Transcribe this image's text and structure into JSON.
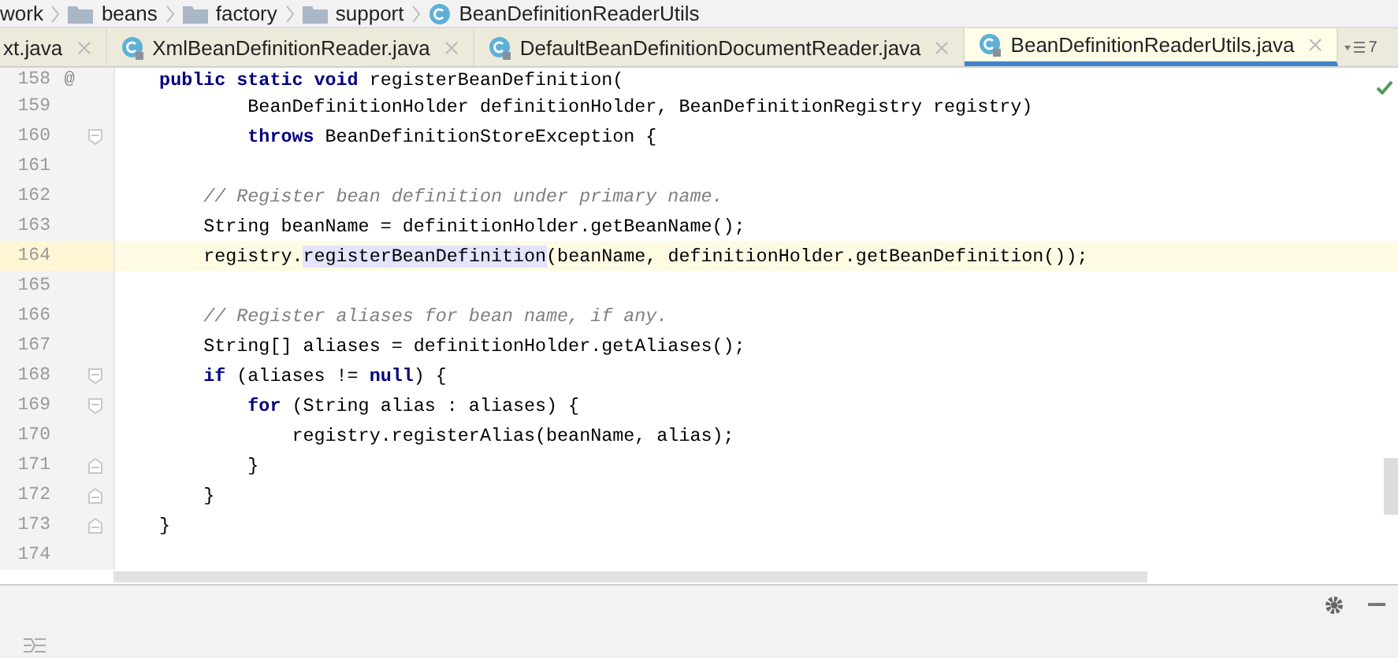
{
  "breadcrumbs": [
    {
      "label": "work",
      "kind": "text"
    },
    {
      "label": "beans",
      "kind": "folder"
    },
    {
      "label": "factory",
      "kind": "folder"
    },
    {
      "label": "support",
      "kind": "folder"
    },
    {
      "label": "BeanDefinitionReaderUtils",
      "kind": "class"
    }
  ],
  "tabs": [
    {
      "label": "xt.java",
      "selected": false,
      "kind": "cut"
    },
    {
      "label": "XmlBeanDefinitionReader.java",
      "selected": false,
      "kind": "class"
    },
    {
      "label": "DefaultBeanDefinitionDocumentReader.java",
      "selected": false,
      "kind": "class"
    },
    {
      "label": "BeanDefinitionReaderUtils.java",
      "selected": true,
      "kind": "class"
    }
  ],
  "tab_overflow": "7",
  "lines": [
    {
      "number": "158",
      "mark": "@",
      "current": false,
      "tokens": [
        {
          "t": "    public static void ",
          "kind": "keyword"
        },
        {
          "t": "registerBeanDefinition(",
          "kind": "plain"
        }
      ]
    },
    {
      "number": "159",
      "current": false,
      "tokens": [
        {
          "t": "            BeanDefinitionHolder definitionHolder, BeanDefinitionRegistry registry)",
          "kind": "plain"
        }
      ]
    },
    {
      "number": "160",
      "fold_start": true,
      "current": false,
      "tokens": [
        {
          "t": "            throws ",
          "kind": "keyword"
        },
        {
          "t": "BeanDefinitionStoreException {",
          "kind": "plain"
        }
      ]
    },
    {
      "number": "161",
      "current": false
    },
    {
      "number": "162",
      "current": false,
      "tokens": [
        {
          "t": "        // Register bean definition under primary name.",
          "kind": "comment"
        }
      ]
    },
    {
      "number": "163",
      "current": false,
      "tokens": [
        {
          "t": "        String beanName = definitionHolder.getBeanName();",
          "kind": "plain"
        }
      ]
    },
    {
      "number": "164",
      "current": true,
      "tokens": [
        {
          "t": "        registry.",
          "kind": "plain"
        },
        {
          "t": "registerBeanDefinition",
          "kind": "usage"
        },
        {
          "t": "(beanName, definitionHolder.getBeanDefinition());",
          "kind": "plain"
        }
      ]
    },
    {
      "number": "165",
      "current": false
    },
    {
      "number": "166",
      "current": false,
      "tokens": [
        {
          "t": "        // Register aliases for bean name, if any.",
          "kind": "comment"
        }
      ]
    },
    {
      "number": "167",
      "current": false,
      "tokens": [
        {
          "t": "        String[] aliases = definitionHolder.getAliases();",
          "kind": "plain"
        }
      ]
    },
    {
      "number": "168",
      "fold_start": true,
      "current": false,
      "tokens": [
        {
          "t": "        if ",
          "kind": "keyword"
        },
        {
          "t": "(aliases != ",
          "kind": "plain"
        },
        {
          "t": "null",
          "kind": "keyword"
        },
        {
          "t": ") {",
          "kind": "plain"
        }
      ]
    },
    {
      "number": "169",
      "fold_start": true,
      "current": false,
      "tokens": [
        {
          "t": "            for ",
          "kind": "keyword"
        },
        {
          "t": "(String alias : aliases) {",
          "kind": "plain"
        }
      ]
    },
    {
      "number": "170",
      "current": false,
      "tokens": [
        {
          "t": "                registry.registerAlias(beanName, alias);",
          "kind": "plain"
        }
      ]
    },
    {
      "number": "171",
      "fold_end": true,
      "current": false,
      "tokens": [
        {
          "t": "            }",
          "kind": "plain"
        }
      ]
    },
    {
      "number": "172",
      "fold_end": true,
      "current": false,
      "tokens": [
        {
          "t": "        }",
          "kind": "plain"
        }
      ]
    },
    {
      "number": "173",
      "fold_end": true,
      "current": false,
      "tokens": [
        {
          "t": "    }",
          "kind": "plain"
        }
      ]
    },
    {
      "number": "174",
      "current": false
    }
  ]
}
